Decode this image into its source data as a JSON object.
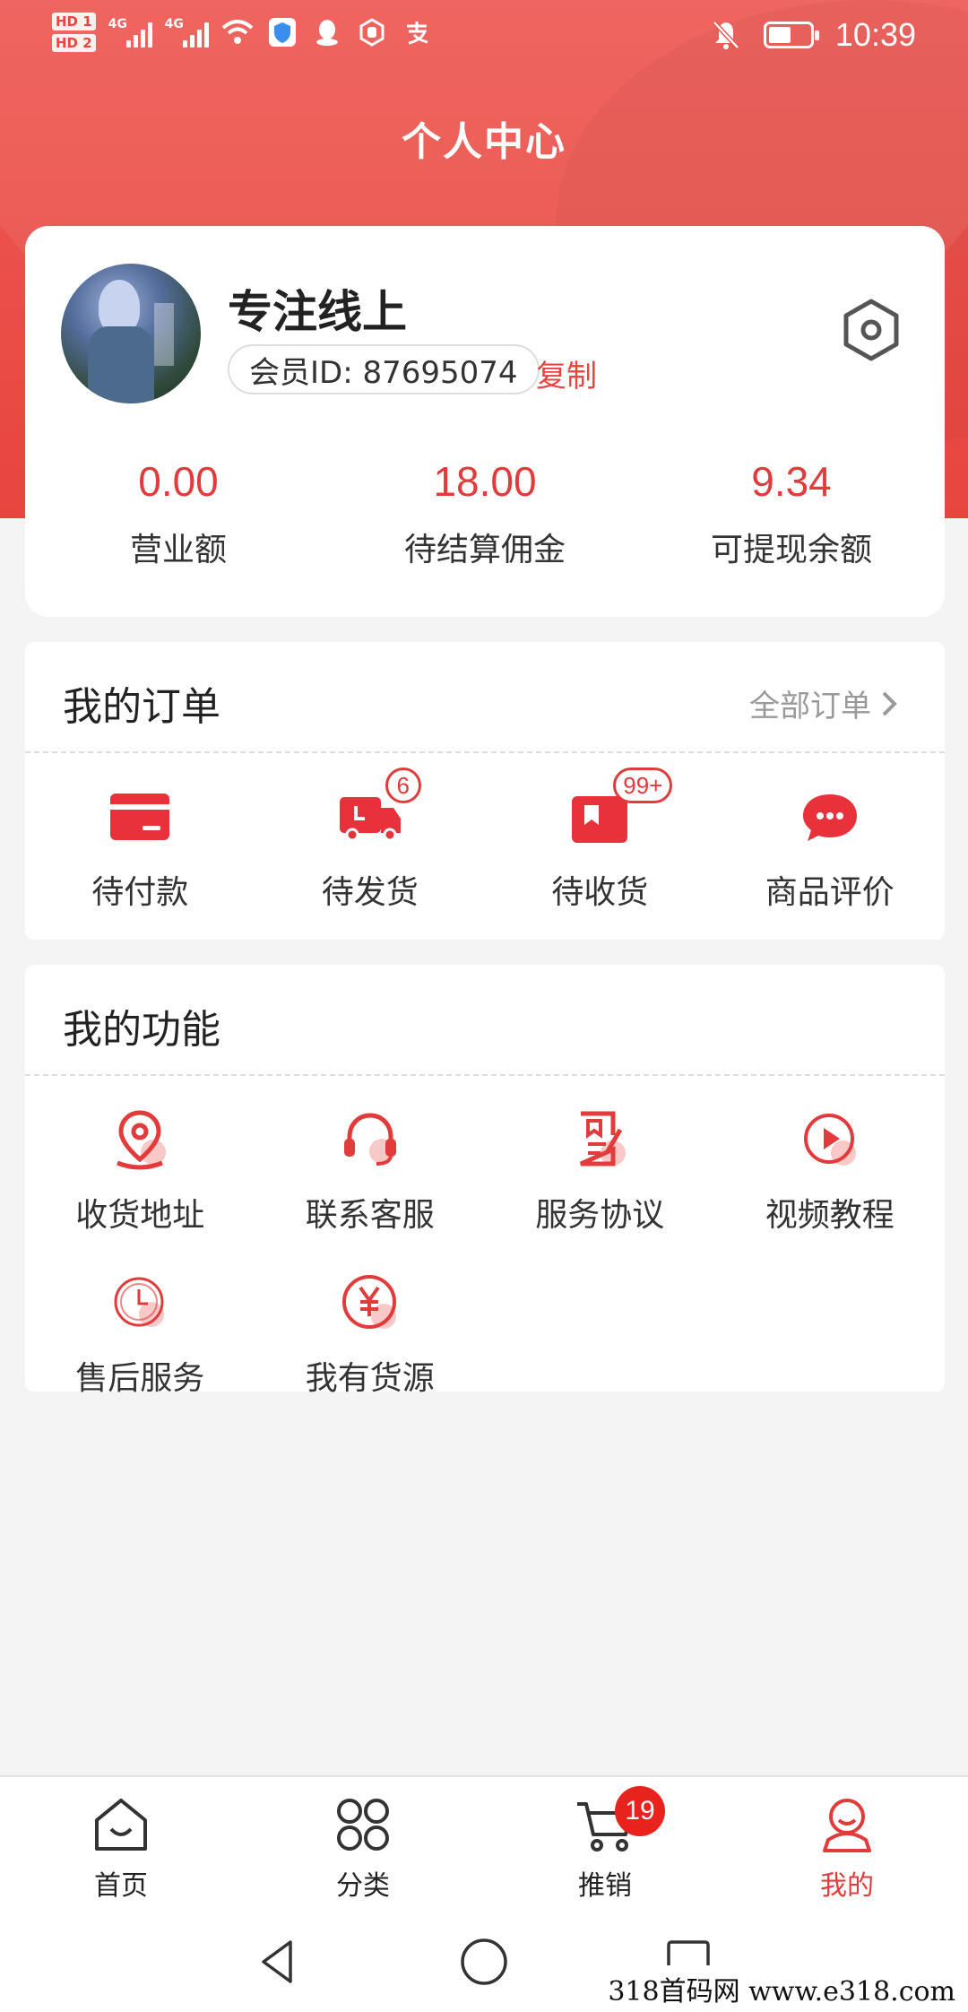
{
  "status_bar": {
    "hd1": "HD 1",
    "hd2": "HD 2",
    "net1": "4G",
    "net2": "4G",
    "time": "10:39"
  },
  "header": {
    "title": "个人中心"
  },
  "profile": {
    "username": "专注线上",
    "member_id": "会员ID: 87695074",
    "copy_label": "复制"
  },
  "stats": [
    {
      "value": "0.00",
      "label": "营业额"
    },
    {
      "value": "18.00",
      "label": "待结算佣金"
    },
    {
      "value": "9.34",
      "label": "可提现余额"
    }
  ],
  "orders": {
    "title": "我的订单",
    "all_label": "全部订单",
    "items": [
      {
        "label": "待付款",
        "icon": "card-icon"
      },
      {
        "label": "待发货",
        "icon": "truck-icon",
        "badge": "6"
      },
      {
        "label": "待收货",
        "icon": "box-icon",
        "badge": "99+"
      },
      {
        "label": "商品评价",
        "icon": "chat-icon"
      }
    ]
  },
  "functions": {
    "title": "我的功能",
    "items": [
      {
        "label": "收货地址",
        "icon": "location-icon"
      },
      {
        "label": "联系客服",
        "icon": "headset-icon"
      },
      {
        "label": "服务协议",
        "icon": "document-icon"
      },
      {
        "label": "视频教程",
        "icon": "play-icon"
      },
      {
        "label": "售后服务",
        "icon": "clock-icon"
      },
      {
        "label": "我有货源",
        "icon": "yen-icon"
      }
    ]
  },
  "tabbar": {
    "items": [
      {
        "label": "首页",
        "icon": "home-icon"
      },
      {
        "label": "分类",
        "icon": "grid-icon"
      },
      {
        "label": "推销",
        "icon": "cart-icon",
        "badge": "19"
      },
      {
        "label": "我的",
        "icon": "user-icon",
        "active": true
      }
    ]
  },
  "watermark": "318首码网 www.e318.com",
  "colors": {
    "brand_red": "#e8453f",
    "accent_red": "#e23b3b",
    "background": "#f4f4f5"
  }
}
